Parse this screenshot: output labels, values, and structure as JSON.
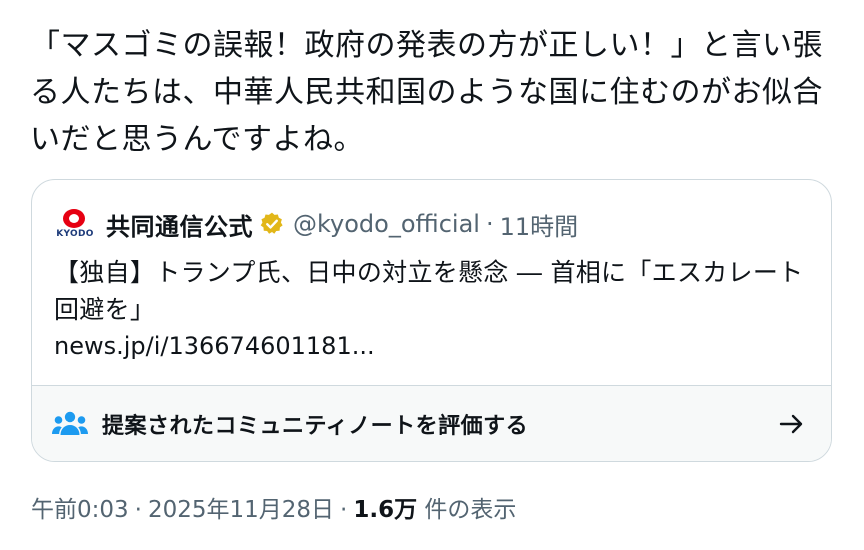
{
  "tweet": {
    "text": "「マスゴミの誤報！政府の発表の方が正しい！」と言い張る人たちは、中華人民共和国のような国に住むのがお似合いだと思うんですよね。"
  },
  "quote": {
    "logo_text": "KYODO",
    "author_name": "共同通信公式",
    "handle": "@kyodo_official",
    "dot": "·",
    "time": "11時間",
    "body": "【独自】トランプ氏、日中の対立を懸念 ― 首相に「エスカレート回避を」",
    "link": "news.jp/i/136674601181..."
  },
  "community_note": {
    "label": "提案されたコミュニティノートを評価する"
  },
  "meta": {
    "time": "午前0:03",
    "sep1": "·",
    "date": "2025年11月28日",
    "sep2": "·",
    "views_count": "1.6万",
    "views_label": "件の表示"
  },
  "colors": {
    "text": "#0f1419",
    "secondary": "#536471",
    "border": "#cfd9de",
    "verified_gold": "#e2b719",
    "people_icon": "#1d9bf0",
    "kyodo_red": "#e60012"
  },
  "icons": [
    "kyodo-logo",
    "verified-badge-icon",
    "people-icon",
    "arrow-right-icon"
  ]
}
